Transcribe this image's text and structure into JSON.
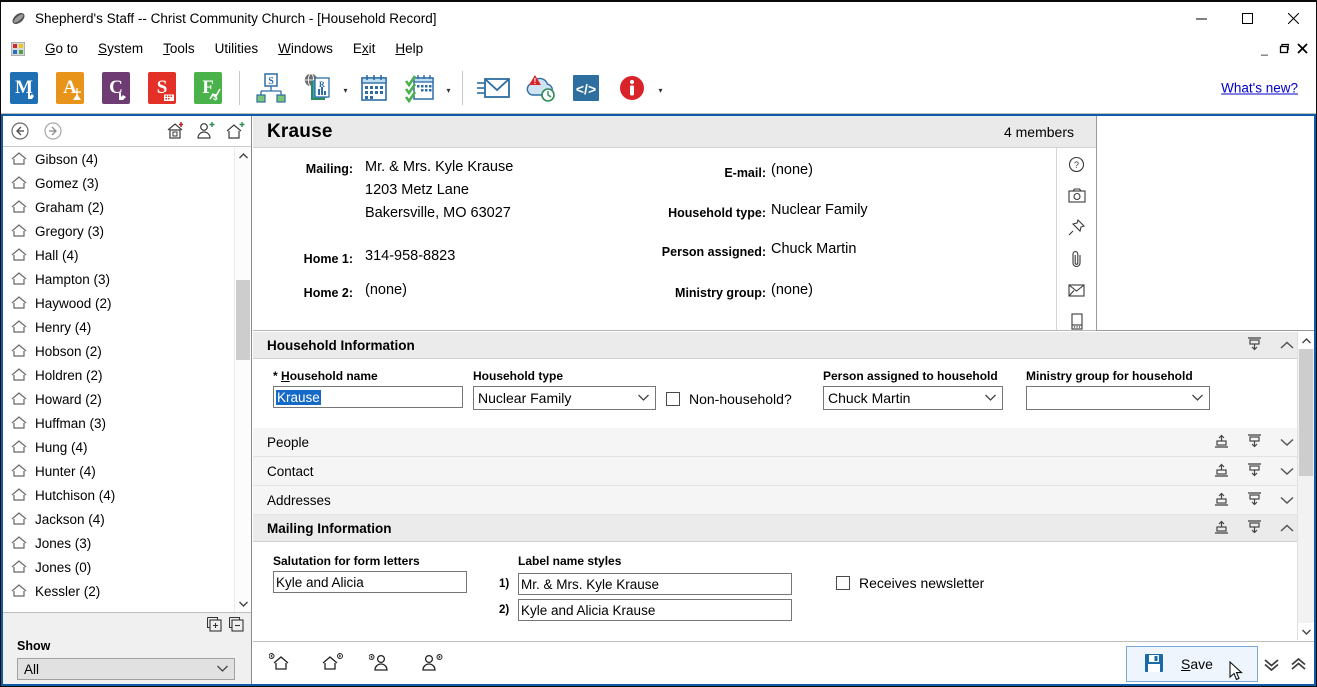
{
  "window": {
    "title": "Shepherd's Staff -- Christ Community Church - [Household Record]",
    "minimize": "—",
    "maximize": "☐",
    "close": "✕",
    "mdi_minimize": "_",
    "mdi_restore": "❐",
    "mdi_close": "✕"
  },
  "menu": {
    "items": [
      {
        "pre": "",
        "hot": "G",
        "post": "o to"
      },
      {
        "pre": "",
        "hot": "S",
        "post": "ystem"
      },
      {
        "pre": "",
        "hot": "T",
        "post": "ools"
      },
      {
        "pre": "U",
        "hot": "t",
        "post": "ilities"
      },
      {
        "pre": "",
        "hot": "W",
        "post": "indows"
      },
      {
        "pre": "E",
        "hot": "x",
        "post": "it"
      },
      {
        "pre": "",
        "hot": "H",
        "post": "elp"
      }
    ]
  },
  "toolbar": {
    "buttons": [
      {
        "name": "membership-icon",
        "letter": "M",
        "color": "#1f6fb5"
      },
      {
        "name": "attendance-icon",
        "letter": "A",
        "color": "#e8941a"
      },
      {
        "name": "contributions-icon",
        "letter": "C",
        "color": "#6e3b72"
      },
      {
        "name": "schedule-icon",
        "letter": "S",
        "color": "#e33128"
      },
      {
        "name": "finance-icon",
        "letter": "F",
        "color": "#49b24a"
      },
      {
        "name": "sites-icon",
        "letter": "S",
        "color": "#3e87c8"
      },
      {
        "name": "reports-icon",
        "letter": "R",
        "color": "#3e87c8"
      },
      {
        "name": "calendar-icon",
        "letter": "",
        "color": "#3e87c8"
      },
      {
        "name": "tasks-icon",
        "letter": "",
        "color": "#49b24a"
      },
      {
        "name": "email-icon",
        "letter": "",
        "color": "#3e87c8"
      },
      {
        "name": "cloud-backup-icon",
        "letter": "",
        "color": "#3e87c8"
      },
      {
        "name": "code-icon",
        "letter": "",
        "color": "#2f6f9f"
      },
      {
        "name": "info-icon",
        "letter": "",
        "color": "#d8232a"
      }
    ],
    "whats_new": "What's new?"
  },
  "sidebar": {
    "nav_back": "←",
    "nav_forward": "→",
    "add_buttons": [
      "add-household-record-icon",
      "add-person-icon",
      "add-home-icon"
    ],
    "items": [
      {
        "label": "Gibson (4)"
      },
      {
        "label": "Gomez (3)"
      },
      {
        "label": "Graham (2)"
      },
      {
        "label": "Gregory (3)"
      },
      {
        "label": "Hall (4)"
      },
      {
        "label": "Hampton (3)"
      },
      {
        "label": "Haywood (2)"
      },
      {
        "label": "Henry (4)"
      },
      {
        "label": "Hobson (2)"
      },
      {
        "label": "Holdren (2)"
      },
      {
        "label": "Howard (2)"
      },
      {
        "label": "Huffman (3)"
      },
      {
        "label": "Hung (4)"
      },
      {
        "label": "Hunter (4)"
      },
      {
        "label": "Hutchison (4)"
      },
      {
        "label": "Jackson (4)"
      },
      {
        "label": "Jones (3)"
      },
      {
        "label": "Jones (0)"
      },
      {
        "label": "Kessler (2)"
      }
    ],
    "show_label": "Show",
    "show_value": "All"
  },
  "record_header": {
    "title": "Krause",
    "members": "4 members",
    "left_fields": [
      {
        "label": "Mailing:",
        "value": "Mr. & Mrs. Kyle Krause"
      },
      {
        "label": "",
        "value": "1203 Metz Lane"
      },
      {
        "label": "",
        "value": "Bakersville, MO 63027"
      },
      {
        "label": "Home 1:",
        "value": "314-958-8823"
      },
      {
        "label": "Home 2:",
        "value": "(none)"
      }
    ],
    "right_fields": [
      {
        "label": "E-mail:",
        "value": "(none)"
      },
      {
        "label": "Household type:",
        "value": "Nuclear Family"
      },
      {
        "label": "Person assigned:",
        "value": "Chuck Martin"
      },
      {
        "label": "Ministry group:",
        "value": "(none)"
      }
    ],
    "side_icons": [
      "help-icon",
      "camera-icon",
      "pushpin-icon",
      "paperclip-icon",
      "envelope-icon",
      "notes-icon"
    ]
  },
  "household_information": {
    "section_title": "Household Information",
    "household_name_label_required": "*",
    "household_name_label_pre": "",
    "household_name_label_hot": "H",
    "household_name_label_post": "ousehold name",
    "household_name_value": "Krause",
    "household_type_label": "Household type",
    "household_type_value": "Nuclear Family",
    "non_household_label": "Non-household?",
    "non_household_checked": false,
    "person_assigned_label": "Person assigned to household",
    "person_assigned_value": "Chuck Martin",
    "ministry_group_label": "Ministry group for household",
    "ministry_group_value": ""
  },
  "collapsed_sections": [
    {
      "label": "People"
    },
    {
      "label": "Contact"
    },
    {
      "label": "Addresses"
    }
  ],
  "mailing_information": {
    "section_title": "Mailing Information",
    "salutation_label": "Salutation for form letters",
    "salutation_value": "Kyle and Alicia",
    "label_styles_label": "Label name styles",
    "style_1_num": "1)",
    "style_1_value": "Mr. & Mrs. Kyle Krause",
    "style_2_num": "2)",
    "style_2_value": "Kyle and Alicia Krause",
    "newsletter_label": "Receives newsletter",
    "newsletter_checked": false
  },
  "bottom_bar": {
    "icons": [
      "previous-household-icon",
      "next-household-icon",
      "previous-person-icon",
      "next-person-icon"
    ],
    "save_pre": "",
    "save_hot": "S",
    "save_post": "ave",
    "collapse_all": "»",
    "expand_all": "«"
  },
  "colors": {
    "frame_blue": "#0e5ca8",
    "accent_link": "#0000cc",
    "selection_blue": "#1569c7",
    "save_border": "#7ba7d7"
  }
}
